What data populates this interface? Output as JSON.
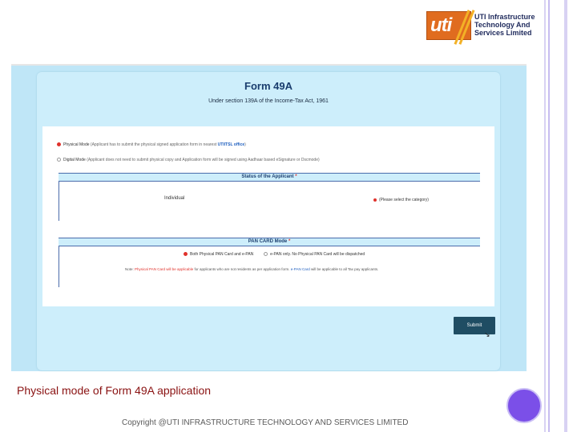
{
  "logo": {
    "mark_text": "uti",
    "company_lines": [
      "UTI Infrastructure",
      "Technology And",
      "Services Limited"
    ]
  },
  "form": {
    "title": "Form 49A",
    "subtitle": "Under section 139A of the Income-Tax Act, 1961",
    "physical_mode_label": "Physical Mode",
    "physical_mode_hint": "(Applicant has to submit the physical signed application form in nearest ",
    "physical_mode_hint_highlight": "UTIITSL office",
    "physical_mode_hint_end": ")",
    "digital_mode_label": "Digital Mode",
    "digital_mode_hint": "(Applicant does not need to submit physical copy and Application form will be signed using Aadhaar based eSignature or Dscmode)",
    "applicant_section_title": "Status of the Applicant",
    "required_star": "*",
    "applicant_value": "Individual",
    "applicant_select_hint": "(Please select the category)",
    "pan_section_title": "PAN CARD Mode",
    "pan_option_1": "Both Physical PAN Card and e-PAN",
    "pan_option_2": "e-PAN only. No Physical PAN Card will be dispatched",
    "note_prefix": "Note: ",
    "note_red": "Physical PAN Card will be applicable",
    "note_middle": " for applicants who are not residents as per application form. ",
    "note_blue": "e-PAN Card",
    "note_end": " will be applicable to all Tax pay applicants.",
    "submit_label": "Submit"
  },
  "caption": "Physical mode of Form 49A application",
  "copyright": "Copyright @UTI INFRASTRUCTURE TECHNOLOGY AND SERVICES LIMITED",
  "colors": {
    "screen_bg": "#bfe6f7",
    "caption": "#8a1212",
    "accent_circle": "#7b4fe8",
    "submit_bg": "#1f4d63"
  }
}
